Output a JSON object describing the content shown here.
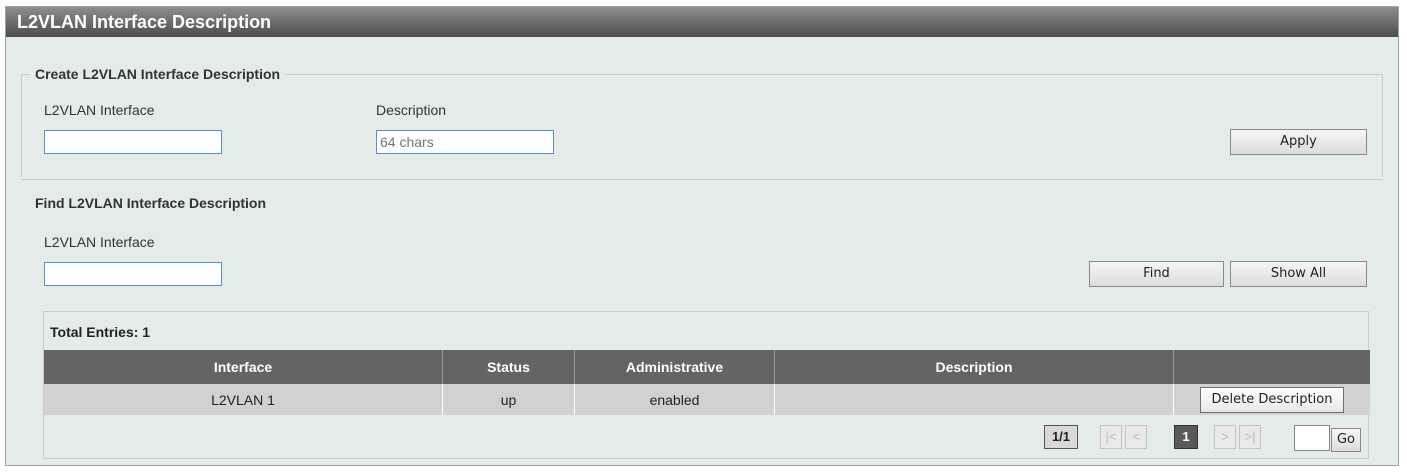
{
  "title": "L2VLAN Interface Description",
  "create": {
    "legend": "Create L2VLAN Interface Description",
    "interface_label": "L2VLAN Interface",
    "interface_value": "",
    "description_label": "Description",
    "description_placeholder": "64 chars",
    "apply_label": "Apply"
  },
  "find": {
    "title": "Find L2VLAN Interface Description",
    "interface_label": "L2VLAN Interface",
    "interface_value": "",
    "find_label": "Find",
    "show_all_label": "Show All"
  },
  "table": {
    "total_entries": "Total Entries: 1",
    "headers": [
      "Interface",
      "Status",
      "Administrative",
      "Description",
      ""
    ],
    "rows": [
      {
        "interface": "L2VLAN 1",
        "status": "up",
        "administrative": "enabled",
        "description": "",
        "action": "Delete Description"
      }
    ]
  },
  "pagination": {
    "page_count": "1/1",
    "first": "|<",
    "prev": "<",
    "current": "1",
    "next": ">",
    "last": ">|",
    "go_label": "Go"
  }
}
